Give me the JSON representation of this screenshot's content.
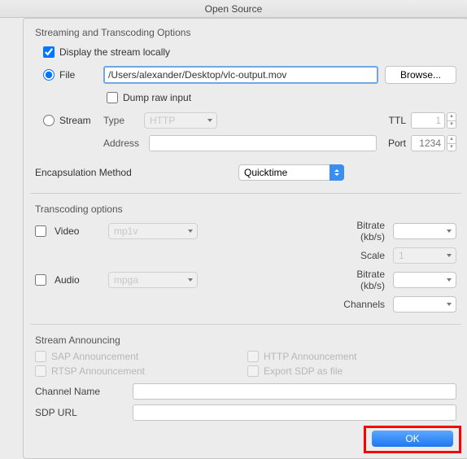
{
  "title": "Open Source",
  "streaming": {
    "heading": "Streaming and Transcoding Options",
    "display_locally": "Display the stream locally",
    "file_label": "File",
    "file_value": "/Users/alexander/Desktop/vlc-output.mov",
    "browse": "Browse...",
    "dump_raw": "Dump raw input",
    "stream_label": "Stream",
    "type_label": "Type",
    "type_value": "HTTP",
    "ttl_label": "TTL",
    "ttl_value": "1",
    "address_label": "Address",
    "port_label": "Port",
    "port_placeholder": "1234",
    "encaps_label": "Encapsulation Method",
    "encaps_value": "Quicktime"
  },
  "transcoding": {
    "heading": "Transcoding options",
    "video_label": "Video",
    "video_codec": "mp1v",
    "bitrate_label": "Bitrate (kb/s)",
    "scale_label": "Scale",
    "scale_value": "1",
    "audio_label": "Audio",
    "audio_codec": "mpga",
    "channels_label": "Channels"
  },
  "announcing": {
    "heading": "Stream Announcing",
    "sap": "SAP Announcement",
    "http": "HTTP Announcement",
    "rtsp": "RTSP Announcement",
    "sdp": "Export SDP as file",
    "channel_label": "Channel Name",
    "sdp_label": "SDP URL"
  },
  "ok": "OK"
}
